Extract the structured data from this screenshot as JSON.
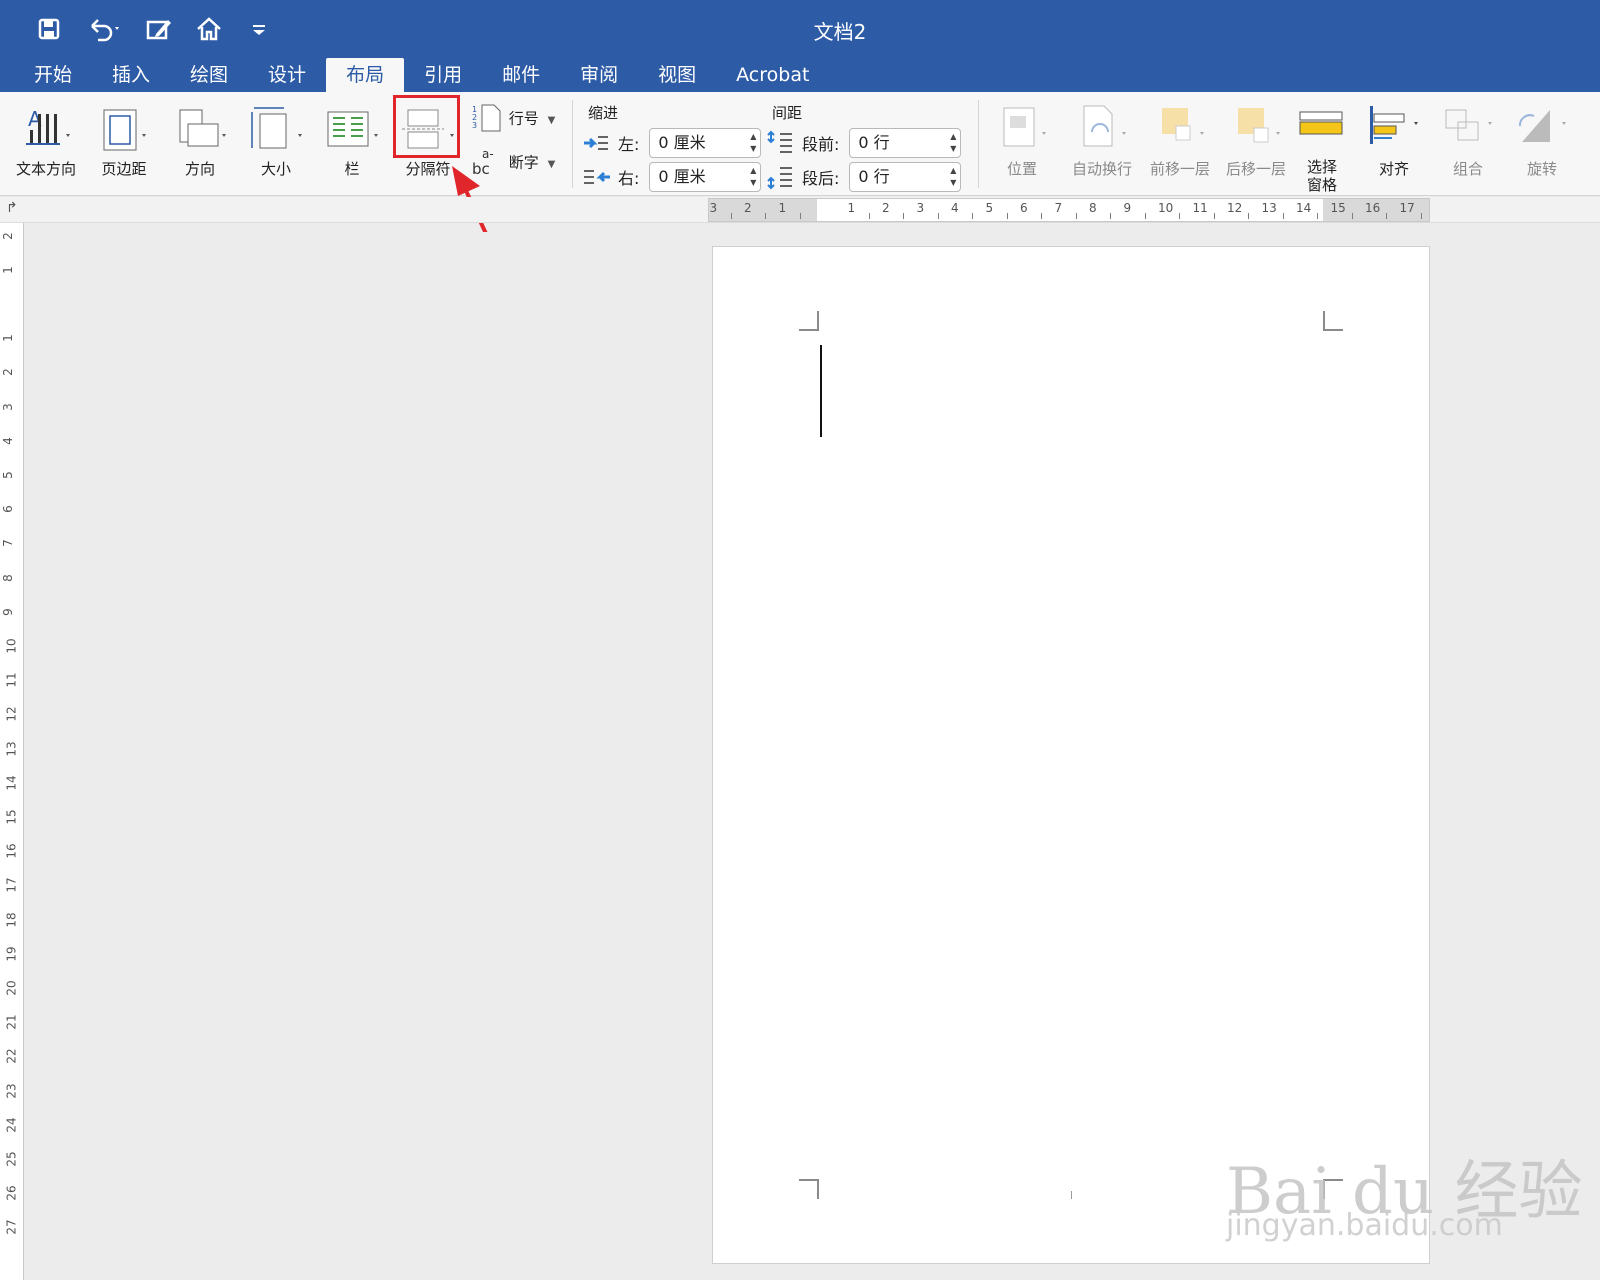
{
  "window": {
    "title": "文档2"
  },
  "quick_access": [
    "save-icon",
    "undo-icon",
    "edit-icon",
    "home-icon",
    "customize-icon"
  ],
  "tabs": [
    {
      "label": "开始"
    },
    {
      "label": "插入"
    },
    {
      "label": "绘图"
    },
    {
      "label": "设计"
    },
    {
      "label": "布局",
      "active": true
    },
    {
      "label": "引用"
    },
    {
      "label": "邮件"
    },
    {
      "label": "审阅"
    },
    {
      "label": "视图"
    },
    {
      "label": "Acrobat"
    }
  ],
  "ribbon": {
    "page_setup": {
      "text_direction": "文本方向",
      "margins": "页边距",
      "orientation": "方向",
      "size": "大小",
      "columns": "栏",
      "breaks": "分隔符",
      "line_numbers": "行号",
      "hyphenation": "断字"
    },
    "indent": {
      "title": "缩进",
      "left_label": "左:",
      "left_value": "0 厘米",
      "right_label": "右:",
      "right_value": "0 厘米"
    },
    "spacing": {
      "title": "间距",
      "before_label": "段前:",
      "before_value": "0 行",
      "after_label": "段后:",
      "after_value": "0 行"
    },
    "arrange": {
      "position": "位置",
      "wrap_text": "自动换行",
      "bring_forward": "前移一层",
      "send_backward": "后移一层",
      "selection_pane_1": "选择",
      "selection_pane_2": "窗格",
      "align": "对齐",
      "group": "组合",
      "rotate": "旋转"
    }
  },
  "ruler": {
    "horizontal": [
      "3",
      "2",
      "1",
      "1",
      "2",
      "3",
      "4",
      "5",
      "6",
      "7",
      "8",
      "9",
      "10",
      "11",
      "12",
      "13",
      "14",
      "15",
      "16",
      "17"
    ],
    "vertical": [
      "2",
      "1",
      "1",
      "2",
      "3",
      "4",
      "5",
      "6",
      "7",
      "8",
      "9",
      "10",
      "11",
      "12",
      "13",
      "14",
      "15",
      "16",
      "17",
      "18",
      "19",
      "20",
      "21",
      "22",
      "23",
      "24",
      "25",
      "26",
      "27"
    ]
  },
  "watermark": {
    "line1": "Bai du 经验",
    "line2": "jingyan.baidu.com"
  },
  "colors": {
    "accent": "#2d5ba6",
    "highlight": "#e0262b"
  }
}
